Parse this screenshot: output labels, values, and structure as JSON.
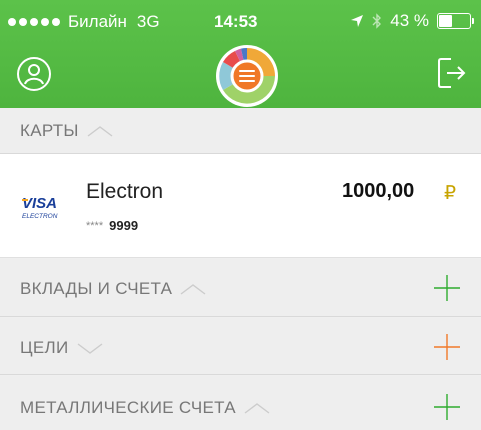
{
  "status_bar": {
    "carrier": "Билайн",
    "network": "3G",
    "time": "14:53",
    "battery": "43 %",
    "battery_level": 0.43
  },
  "header": {
    "profile_icon": "user-icon",
    "menu_icon": "menu-icon",
    "logout_icon": "logout-icon"
  },
  "sections": {
    "cards": {
      "label": "КАРТЫ",
      "state": "expanded"
    },
    "deposits": {
      "label": "ВКЛАДЫ И СЧЕТА",
      "state": "expanded",
      "plus_color": "#2eab2e"
    },
    "goals": {
      "label": "ЦЕЛИ",
      "state": "collapsed",
      "plus_color": "#f07828"
    },
    "metals": {
      "label": "МЕТАЛЛИЧЕСКИЕ СЧЕТА",
      "state": "expanded",
      "plus_color": "#2eab2e"
    }
  },
  "card": {
    "brand": "VISA",
    "brand_sub": "ELECTRON",
    "name": "Electron",
    "mask": "****",
    "number": "9999",
    "amount": "1000,00",
    "currency": "₽"
  },
  "colors": {
    "header_green": "#55bb44",
    "accent_orange": "#f07828",
    "accent_green": "#2eab2e"
  }
}
